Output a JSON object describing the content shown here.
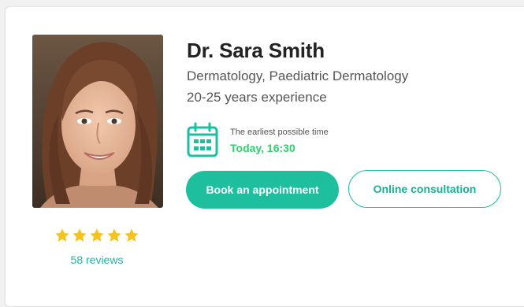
{
  "doctor": {
    "name": "Dr. Sara Smith",
    "specialty": "Dermatology, Paediatric Dermatology",
    "experience": "20-25 years experience"
  },
  "rating": {
    "stars": 5,
    "max_stars": 5,
    "reviews_label": "58 reviews"
  },
  "availability": {
    "label": "The earliest possible time",
    "value": "Today, 16:30",
    "icon": "calendar-icon"
  },
  "actions": {
    "book_label": "Book an appointment",
    "online_label": "Online consultation"
  },
  "colors": {
    "accent": "#1dbf9f",
    "availability": "#2ed16e",
    "star": "#f6c21c"
  }
}
